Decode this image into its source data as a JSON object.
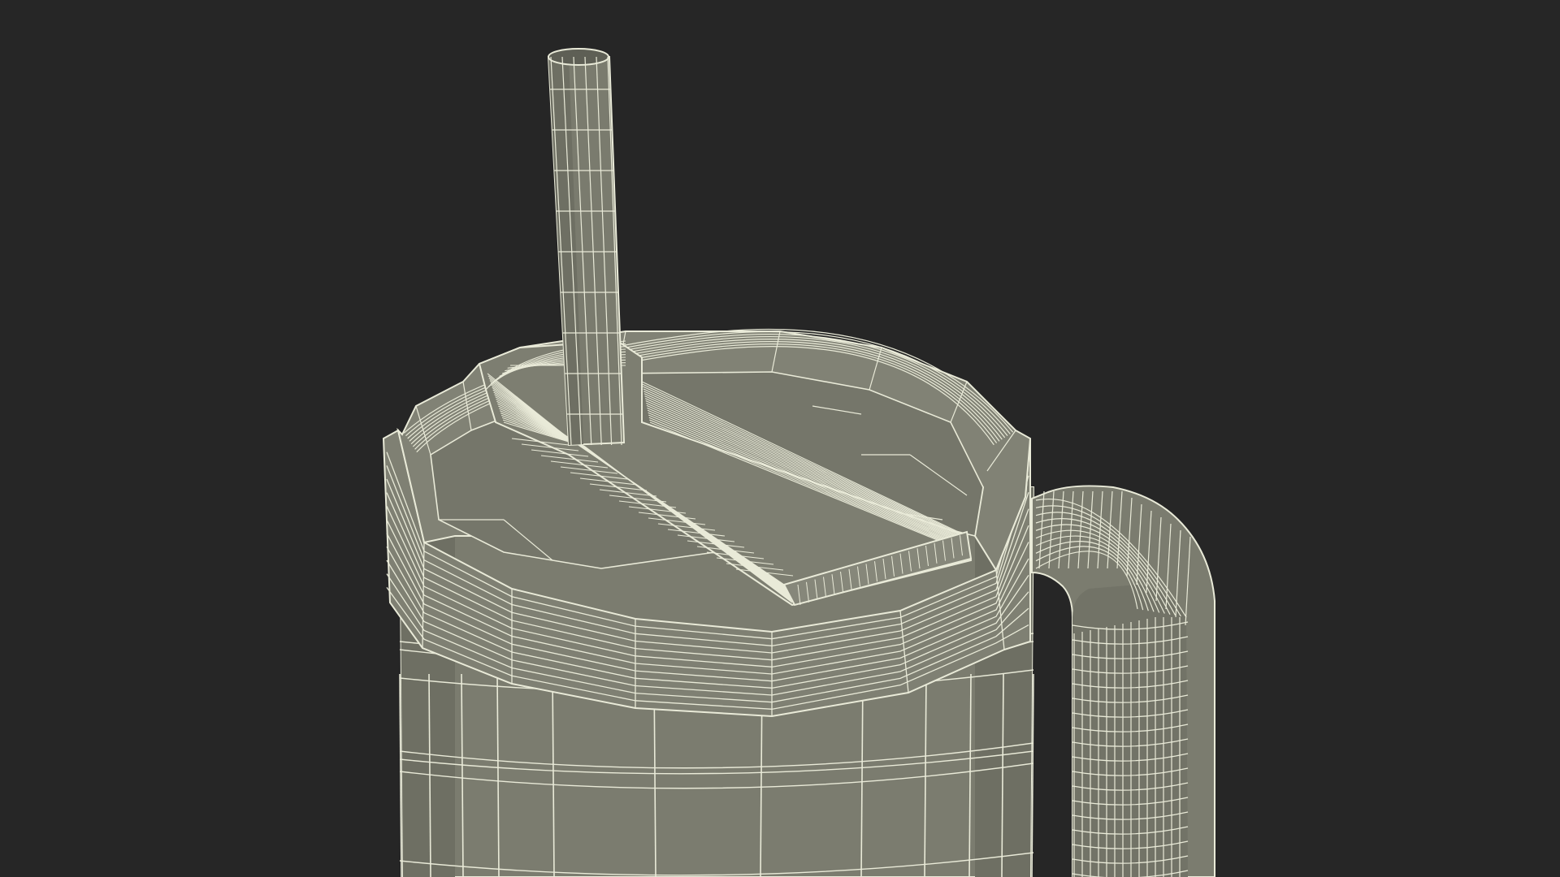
{
  "scene": {
    "subject": "tumbler-with-straw-and-handle-wireframe",
    "render_mode": "wireframe",
    "colors": {
      "background": "#262626",
      "surface": "#7c7d70",
      "surface_dark": "#6b6c60",
      "surface_light": "#8a8b7e",
      "wire": "#e9ead8"
    }
  }
}
